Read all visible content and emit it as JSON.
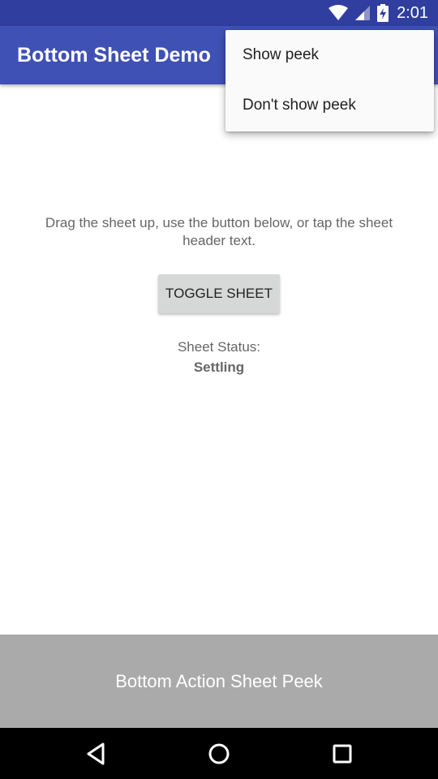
{
  "status_bar": {
    "time": "2:01",
    "icons": [
      "wifi-icon",
      "cell-signal-icon",
      "battery-charging-icon"
    ]
  },
  "app_bar": {
    "title": "Bottom Sheet Demo"
  },
  "overflow_menu": {
    "items": [
      {
        "label": "Show peek"
      },
      {
        "label": "Don't show peek"
      }
    ]
  },
  "main": {
    "instructions": "Drag the sheet up, use the button below, or tap the sheet header text.",
    "toggle_button_label": "TOGGLE SHEET",
    "status_label": "Sheet Status:",
    "status_value": "Settling"
  },
  "bottom_sheet": {
    "peek_text": "Bottom Action Sheet Peek"
  },
  "nav_bar": {
    "buttons": [
      "back-icon",
      "home-icon",
      "recents-icon"
    ]
  },
  "colors": {
    "status_bar": "#303f9f",
    "app_bar": "#3f51b5",
    "sheet": "#aaaaaa",
    "button": "#d6d7d7"
  }
}
